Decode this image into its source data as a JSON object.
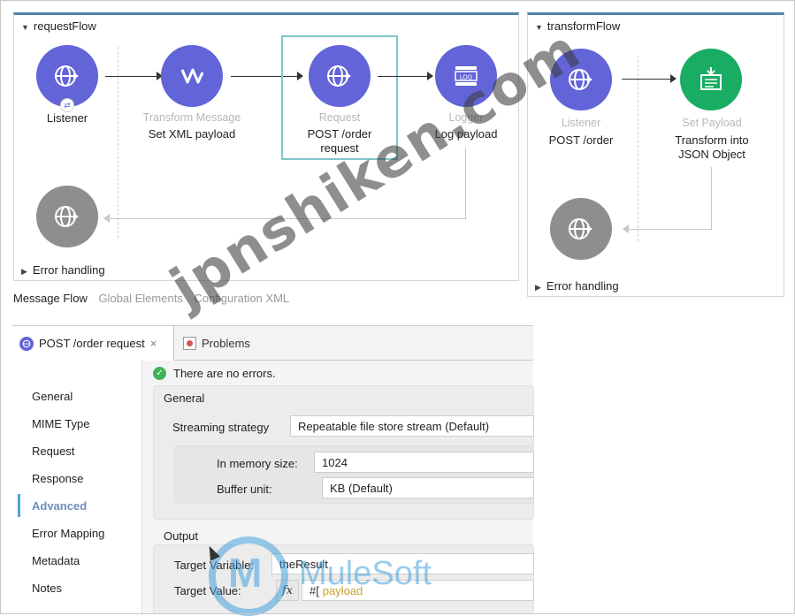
{
  "request_flow": {
    "title": "requestFlow",
    "nodes": [
      {
        "type": "",
        "label": "Listener"
      },
      {
        "type": "Transform Message",
        "label": "Set XML payload"
      },
      {
        "type": "Request",
        "label": "POST /order\nrequest"
      },
      {
        "type": "Logger",
        "label": "Log payload"
      }
    ],
    "logger_icon_text": "LOG",
    "error_handling": "Error handling"
  },
  "transform_flow": {
    "title": "transformFlow",
    "nodes": [
      {
        "type": "Listener",
        "label": "POST /order"
      },
      {
        "type": "Set Payload",
        "label": "Transform into\nJSON Object"
      }
    ],
    "error_handling": "Error handling"
  },
  "view_tabs": [
    "Message Flow",
    "Global Elements",
    "Configuration XML"
  ],
  "editor_tabs": {
    "active": "POST /order request",
    "close": "×",
    "other": "Problems"
  },
  "props": {
    "status": "There are no errors.",
    "nav": [
      "General",
      "MIME Type",
      "Request",
      "Response",
      "Advanced",
      "Error Mapping",
      "Metadata",
      "Notes"
    ],
    "active_nav": "Advanced",
    "general": {
      "title": "General",
      "streaming_label": "Streaming strategy",
      "streaming_value": "Repeatable file store stream (Default)",
      "memory_label": "In memory size:",
      "memory_value": "1024",
      "buffer_label": "Buffer unit:",
      "buffer_value": "KB (Default)"
    },
    "output": {
      "title": "Output",
      "target_variable_label": "Target Variable:",
      "target_variable_value": "theResult",
      "target_value_label": "Target Value:",
      "fx": "fx",
      "target_value_prefix": "#[",
      "target_value_value": "payload"
    }
  },
  "watermark": {
    "text": "jpnshiken.com",
    "brand": "MuleSoft"
  },
  "colors": {
    "connector_blue": "#6264d8",
    "set_payload_green": "#18ad63",
    "error_gray": "#8e8e8e",
    "flow_header": "#4f86a8",
    "selection": "#7fc7c9"
  }
}
